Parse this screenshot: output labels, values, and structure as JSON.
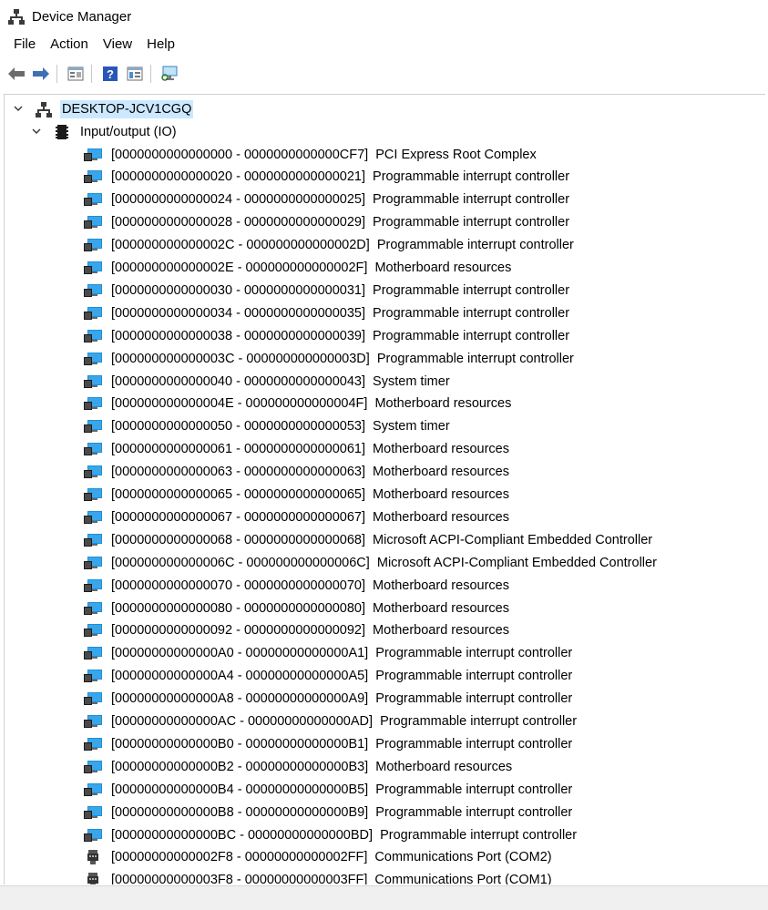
{
  "window": {
    "title": "Device Manager"
  },
  "menu": [
    "File",
    "Action",
    "View",
    "Help"
  ],
  "toolbar": {
    "buttons": [
      "back-arrow-icon",
      "forward-arrow-icon",
      "properties-icon",
      "help-icon",
      "device-properties-icon",
      "scan-hardware-icon"
    ]
  },
  "tree": {
    "root": "DESKTOP-JCV1CGQ",
    "category": "Input/output (IO)",
    "devices": [
      {
        "label": "[0000000000000000 - 0000000000000CF7]  PCI Express Root Complex",
        "icon": "monitor-icon"
      },
      {
        "label": "[0000000000000020 - 0000000000000021]  Programmable interrupt controller",
        "icon": "monitor-icon"
      },
      {
        "label": "[0000000000000024 - 0000000000000025]  Programmable interrupt controller",
        "icon": "monitor-icon"
      },
      {
        "label": "[0000000000000028 - 0000000000000029]  Programmable interrupt controller",
        "icon": "monitor-icon"
      },
      {
        "label": "[000000000000002C - 000000000000002D]  Programmable interrupt controller",
        "icon": "monitor-icon"
      },
      {
        "label": "[000000000000002E - 000000000000002F]  Motherboard resources",
        "icon": "monitor-icon"
      },
      {
        "label": "[0000000000000030 - 0000000000000031]  Programmable interrupt controller",
        "icon": "monitor-icon"
      },
      {
        "label": "[0000000000000034 - 0000000000000035]  Programmable interrupt controller",
        "icon": "monitor-icon"
      },
      {
        "label": "[0000000000000038 - 0000000000000039]  Programmable interrupt controller",
        "icon": "monitor-icon"
      },
      {
        "label": "[000000000000003C - 000000000000003D]  Programmable interrupt controller",
        "icon": "monitor-icon"
      },
      {
        "label": "[0000000000000040 - 0000000000000043]  System timer",
        "icon": "monitor-icon"
      },
      {
        "label": "[000000000000004E - 000000000000004F]  Motherboard resources",
        "icon": "monitor-icon"
      },
      {
        "label": "[0000000000000050 - 0000000000000053]  System timer",
        "icon": "monitor-icon"
      },
      {
        "label": "[0000000000000061 - 0000000000000061]  Motherboard resources",
        "icon": "monitor-icon"
      },
      {
        "label": "[0000000000000063 - 0000000000000063]  Motherboard resources",
        "icon": "monitor-icon"
      },
      {
        "label": "[0000000000000065 - 0000000000000065]  Motherboard resources",
        "icon": "monitor-icon"
      },
      {
        "label": "[0000000000000067 - 0000000000000067]  Motherboard resources",
        "icon": "monitor-icon"
      },
      {
        "label": "[0000000000000068 - 0000000000000068]  Microsoft ACPI-Compliant Embedded Controller",
        "icon": "monitor-icon"
      },
      {
        "label": "[000000000000006C - 000000000000006C]  Microsoft ACPI-Compliant Embedded Controller",
        "icon": "monitor-icon"
      },
      {
        "label": "[0000000000000070 - 0000000000000070]  Motherboard resources",
        "icon": "monitor-icon"
      },
      {
        "label": "[0000000000000080 - 0000000000000080]  Motherboard resources",
        "icon": "monitor-icon"
      },
      {
        "label": "[0000000000000092 - 0000000000000092]  Motherboard resources",
        "icon": "monitor-icon"
      },
      {
        "label": "[00000000000000A0 - 00000000000000A1]  Programmable interrupt controller",
        "icon": "monitor-icon"
      },
      {
        "label": "[00000000000000A4 - 00000000000000A5]  Programmable interrupt controller",
        "icon": "monitor-icon"
      },
      {
        "label": "[00000000000000A8 - 00000000000000A9]  Programmable interrupt controller",
        "icon": "monitor-icon"
      },
      {
        "label": "[00000000000000AC - 00000000000000AD]  Programmable interrupt controller",
        "icon": "monitor-icon"
      },
      {
        "label": "[00000000000000B0 - 00000000000000B1]  Programmable interrupt controller",
        "icon": "monitor-icon"
      },
      {
        "label": "[00000000000000B2 - 00000000000000B3]  Motherboard resources",
        "icon": "monitor-icon"
      },
      {
        "label": "[00000000000000B4 - 00000000000000B5]  Programmable interrupt controller",
        "icon": "monitor-icon"
      },
      {
        "label": "[00000000000000B8 - 00000000000000B9]  Programmable interrupt controller",
        "icon": "monitor-icon"
      },
      {
        "label": "[00000000000000BC - 00000000000000BD]  Programmable interrupt controller",
        "icon": "monitor-icon"
      },
      {
        "label": "[00000000000002F8 - 00000000000002FF]  Communications Port (COM2)",
        "icon": "port-icon"
      },
      {
        "label": "[00000000000003F8 - 00000000000003FF]  Communications Port (COM1)",
        "icon": "port-icon"
      }
    ]
  },
  "colors": {
    "selection": "#cce8ff",
    "device_icon": "#1e8fd8",
    "statusbar": "#f0f0f0"
  }
}
